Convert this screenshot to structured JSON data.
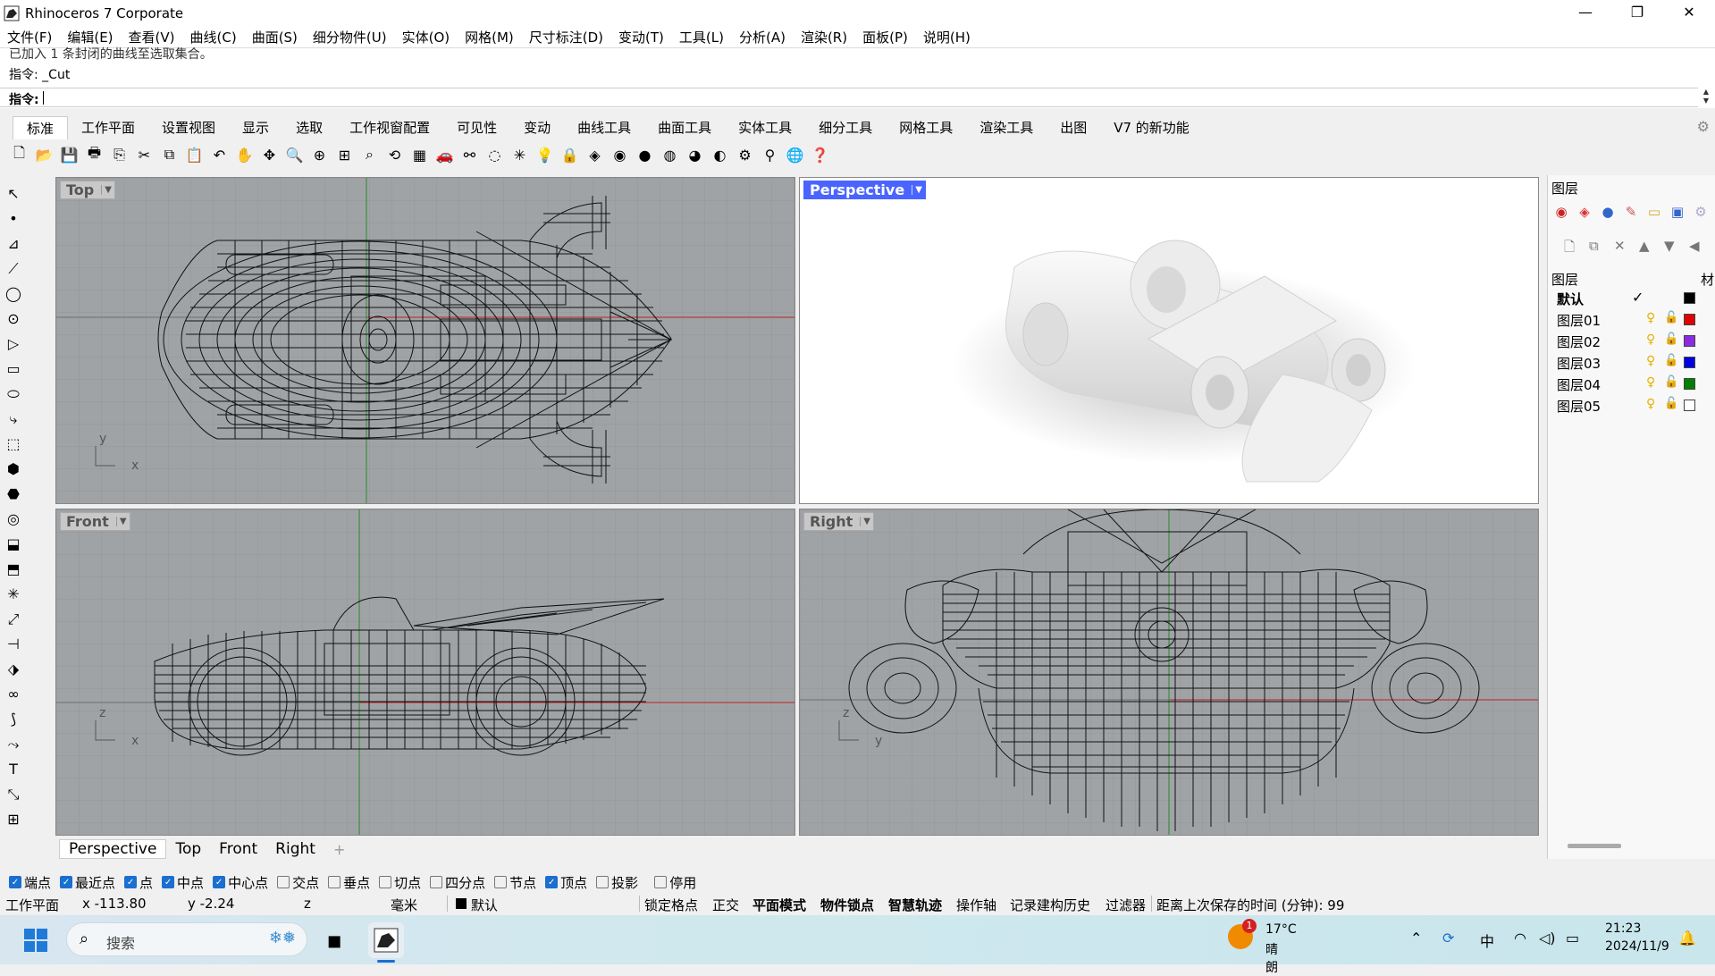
{
  "window": {
    "title": "Rhinoceros 7 Corporate",
    "controls": [
      "—",
      "❐",
      "✕"
    ]
  },
  "menu": [
    "文件(F)",
    "编辑(E)",
    "查看(V)",
    "曲线(C)",
    "曲面(S)",
    "细分物件(U)",
    "实体(O)",
    "网格(M)",
    "尺寸标注(D)",
    "变动(T)",
    "工具(L)",
    "分析(A)",
    "渲染(R)",
    "面板(P)",
    "说明(H)"
  ],
  "command": {
    "history_line1": "已加入 1 条封闭的曲线至选取集合。",
    "history_line2": "指令: _Cut",
    "prompt": "指令:"
  },
  "tabs": [
    "标准",
    "工作平面",
    "设置视图",
    "显示",
    "选取",
    "工作视窗配置",
    "可见性",
    "变动",
    "曲线工具",
    "曲面工具",
    "实体工具",
    "细分工具",
    "网格工具",
    "渲染工具",
    "出图",
    "V7 的新功能"
  ],
  "toolbar_icons": [
    "new-file-icon",
    "open-icon",
    "save-icon",
    "print-icon",
    "export-icon",
    "cut-icon",
    "copy-icon",
    "paste-icon",
    "undo-icon",
    "pan-hand-icon",
    "rotate-view-icon",
    "zoom-icon",
    "zoom-window-icon",
    "zoom-extents-icon",
    "zoom-selected-icon",
    "rotate-icon",
    "grid-icon",
    "car-icon",
    "car-outline-icon",
    "ellipse-icon",
    "snap-icon",
    "light-icon",
    "lock-icon",
    "material-icon",
    "color-wheel-icon",
    "sphere-dark-icon",
    "sphere-shaded-icon",
    "sphere-blue-icon",
    "render-icon",
    "settings-gear-icon",
    "filter-icon",
    "globe-icon",
    "help-icon"
  ],
  "toolbar_glyphs": [
    "🗋",
    "📂",
    "💾",
    "🖶",
    "⎘",
    "✂",
    "⧉",
    "📋",
    "↶",
    "✋",
    "✥",
    "🔍",
    "⊕",
    "⊞",
    "⌕",
    "⟲",
    "▦",
    "🚗",
    "⚯",
    "◌",
    "✳",
    "💡",
    "🔒",
    "◈",
    "◉",
    "●",
    "◍",
    "◕",
    "◐",
    "⚙",
    "⚲",
    "🌐",
    "❓"
  ],
  "left_tools": [
    "↖",
    "•",
    "⊿",
    "⟋",
    "◯",
    "⊙",
    "▷",
    "▭",
    "⬭",
    "⤷",
    "⬚",
    "⬢",
    "⬣",
    "◎",
    "⬓",
    "⬒",
    "✳",
    "⤢",
    "⊣",
    "⬗",
    "∞",
    "⟆",
    "⤳",
    "T",
    "⤡",
    "⊞"
  ],
  "viewports": {
    "top": {
      "label": "Top",
      "axis_y": "y",
      "axis_x": "x"
    },
    "perspective": {
      "label": "Perspective"
    },
    "front": {
      "label": "Front",
      "axis_y": "z",
      "axis_x": "x"
    },
    "right": {
      "label": "Right",
      "axis_y": "z",
      "axis_x": "y"
    }
  },
  "layers_panel": {
    "title": "图层",
    "header": "图层",
    "material_header": "材",
    "layers": [
      {
        "name": "默认",
        "current": true,
        "color": "#000000"
      },
      {
        "name": "图层01",
        "current": false,
        "color": "#e00000"
      },
      {
        "name": "图层02",
        "current": false,
        "color": "#8a2be2"
      },
      {
        "name": "图层03",
        "current": false,
        "color": "#0000e0"
      },
      {
        "name": "图层04",
        "current": false,
        "color": "#008000"
      },
      {
        "name": "图层05",
        "current": false,
        "color": "#ffffff"
      }
    ],
    "check_glyph": "✓"
  },
  "viewport_tabs": [
    "Perspective",
    "Top",
    "Front",
    "Right"
  ],
  "add_tab_glyph": "+",
  "osnap": [
    {
      "label": "端点",
      "on": true
    },
    {
      "label": "最近点",
      "on": true
    },
    {
      "label": "点",
      "on": true
    },
    {
      "label": "中点",
      "on": true
    },
    {
      "label": "中心点",
      "on": true
    },
    {
      "label": "交点",
      "on": false
    },
    {
      "label": "垂点",
      "on": false
    },
    {
      "label": "切点",
      "on": false
    },
    {
      "label": "四分点",
      "on": false
    },
    {
      "label": "节点",
      "on": false
    },
    {
      "label": "顶点",
      "on": true
    },
    {
      "label": "投影",
      "on": false
    },
    {
      "label": "停用",
      "on": false
    }
  ],
  "status": {
    "cplane": "工作平面",
    "x": "x -113.80",
    "y": "y -2.24",
    "z": "z",
    "units": "毫米",
    "layer": "默认",
    "grid_snap": "锁定格点",
    "ortho": "正交",
    "planar": "平面模式",
    "osnap": "物件锁点",
    "smarttrack": "智慧轨迹",
    "gumball": "操作轴",
    "history": "记录建构历史",
    "filter": "过滤器",
    "save_time": "距离上次保存的时间 (分钟): 99"
  },
  "taskbar": {
    "search_placeholder": "搜索",
    "weather_temp": "17°C",
    "weather_desc": "晴朗",
    "weather_badge": "1",
    "ime": "中",
    "time": "21:23",
    "date": "2024/11/9"
  }
}
